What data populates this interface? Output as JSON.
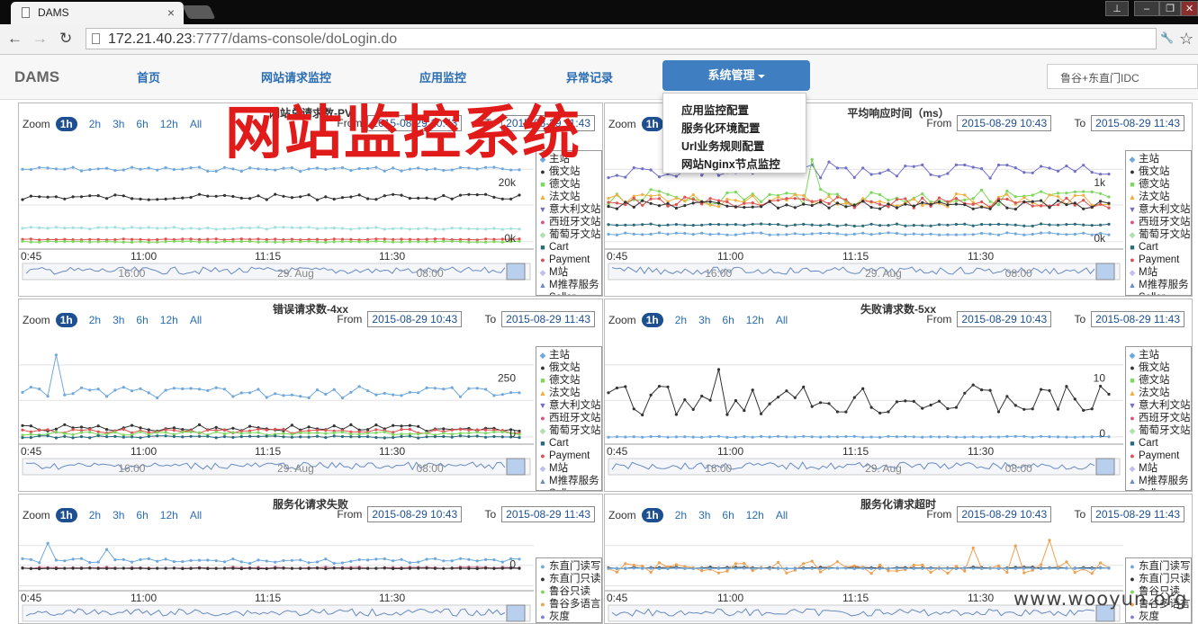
{
  "browser": {
    "tab_title": "DAMS",
    "tab_close": "×",
    "url_host": "172.21.40.23",
    "url_path": ":7777/dams-console/doLogin.do",
    "window_buttons": [
      "⊥",
      "–",
      "❐",
      "✕"
    ],
    "nav_glyphs": {
      "back": "←",
      "forward": "→",
      "reload": "↻",
      "star": "☆",
      "wrench": "🔧"
    }
  },
  "app": {
    "brand": "DAMS",
    "nav": [
      "首页",
      "网站请求监控",
      "应用监控",
      "异常记录"
    ],
    "active_nav": "系统管理",
    "idc_select": "鲁谷+东直门IDC",
    "dropdown": [
      "应用监控配置",
      "服务化环境配置",
      "Url业务规则配置",
      "网站Nginx节点监控"
    ]
  },
  "overlay": {
    "title": "网站监控系统",
    "footer": "www.wooyun.org"
  },
  "colors": {
    "accent": "#3f7fc1",
    "zoom_selected": "#1d4f91",
    "overlay_red": "#e11a1a"
  },
  "legend_site": [
    "主站",
    "俄文站",
    "德文站",
    "法文站",
    "意大利文站",
    "西班牙文站",
    "葡萄牙文站",
    "Cart",
    "Payment",
    "M站",
    "M推荐服务",
    "Seller"
  ],
  "legend_service": [
    "东直门读写",
    "东直门只读",
    "鲁谷只读",
    "鲁谷多语言",
    "灰度"
  ],
  "panels": [
    {
      "title": "网站总请求数-PV",
      "zoom_label": "Zoom",
      "zoom": [
        "1h",
        "2h",
        "3h",
        "6h",
        "12h",
        "All"
      ],
      "from_label": "From",
      "from": "2015-08-29 10:43",
      "to_label": "To",
      "to": "2015-08-29 11:43",
      "y_ticks": [
        "20k",
        "0k"
      ],
      "x_ticks": [
        "0:45",
        "11:00",
        "11:15",
        "11:30"
      ],
      "nav_ticks": [
        "16:00",
        "29. Aug",
        "08:00"
      ],
      "legend": "site"
    },
    {
      "title": "平均响应时间（ms）",
      "zoom_label": "Zoom",
      "zoom": [
        "1h",
        "2h",
        "3h",
        "6h",
        "12h",
        "All"
      ],
      "from_label": "From",
      "from": "2015-08-29 10:43",
      "to_label": "To",
      "to": "2015-08-29 11:43",
      "y_ticks": [
        "1k",
        "0k"
      ],
      "x_ticks": [
        "0:45",
        "11:00",
        "11:15",
        "11:30"
      ],
      "nav_ticks": [
        "16:00",
        "29. Aug",
        "08:00"
      ],
      "legend": "site"
    },
    {
      "title": "错误请求数-4xx",
      "zoom_label": "Zoom",
      "zoom": [
        "1h",
        "2h",
        "3h",
        "6h",
        "12h",
        "All"
      ],
      "from_label": "From",
      "from": "2015-08-29 10:43",
      "to_label": "To",
      "to": "2015-08-29 11:43",
      "y_ticks": [
        "250",
        "0"
      ],
      "x_ticks": [
        "0:45",
        "11:00",
        "11:15",
        "11:30"
      ],
      "nav_ticks": [
        "16:00",
        "29. Aug",
        "08:00"
      ],
      "legend": "site"
    },
    {
      "title": "失败请求数-5xx",
      "zoom_label": "Zoom",
      "zoom": [
        "1h",
        "2h",
        "3h",
        "6h",
        "12h",
        "All"
      ],
      "from_label": "From",
      "from": "2015-08-29 10:43",
      "to_label": "To",
      "to": "2015-08-29 11:43",
      "y_ticks": [
        "10",
        "0"
      ],
      "x_ticks": [
        "0:45",
        "11:00",
        "11:15",
        "11:30"
      ],
      "nav_ticks": [
        "16:00",
        "29. Aug",
        "08:00"
      ],
      "legend": "site"
    },
    {
      "title": "服务化请求失败",
      "zoom_label": "Zoom",
      "zoom": [
        "1h",
        "2h",
        "3h",
        "6h",
        "12h",
        "All"
      ],
      "from_label": "From",
      "from": "2015-08-29 10:43",
      "to_label": "To",
      "to": "2015-08-29 11:43",
      "y_ticks": [
        "0"
      ],
      "x_ticks": [
        "0:45",
        "11:00",
        "11:15",
        "11:30"
      ],
      "nav_ticks": [],
      "legend": "service"
    },
    {
      "title": "服务化请求超时",
      "zoom_label": "Zoom",
      "zoom": [
        "1h",
        "2h",
        "3h",
        "6h",
        "12h",
        "All"
      ],
      "from_label": "From",
      "from": "2015-08-29 10:43",
      "to_label": "To",
      "to": "2015-08-29 11:43",
      "y_ticks": [],
      "x_ticks": [
        "0:45",
        "11:00",
        "11:15",
        "11:30"
      ],
      "nav_ticks": [],
      "legend": "service"
    }
  ]
}
